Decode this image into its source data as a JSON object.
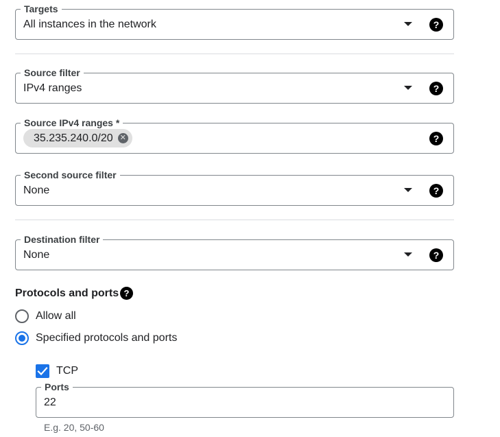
{
  "targets": {
    "label": "Targets",
    "value": "All instances in the network"
  },
  "source_filter": {
    "label": "Source filter",
    "value": "IPv4 ranges"
  },
  "source_ipv4": {
    "label": "Source IPv4 ranges *",
    "chip": "35.235.240.0/20"
  },
  "second_source_filter": {
    "label": "Second source filter",
    "value": "None"
  },
  "destination_filter": {
    "label": "Destination filter",
    "value": "None"
  },
  "protocols": {
    "title": "Protocols and ports",
    "options": [
      "Allow all",
      "Specified protocols and ports"
    ],
    "selected": "Specified protocols and ports",
    "tcp": {
      "label": "TCP",
      "checked": true
    },
    "ports": {
      "label": "Ports",
      "value": "22",
      "hint": "E.g. 20, 50-60"
    }
  },
  "help_glyph": "?",
  "accent_color": "#1a73e8",
  "icons": [
    "dropdown-caret-icon",
    "help-icon",
    "chip-remove-icon",
    "checkmark-icon"
  ]
}
